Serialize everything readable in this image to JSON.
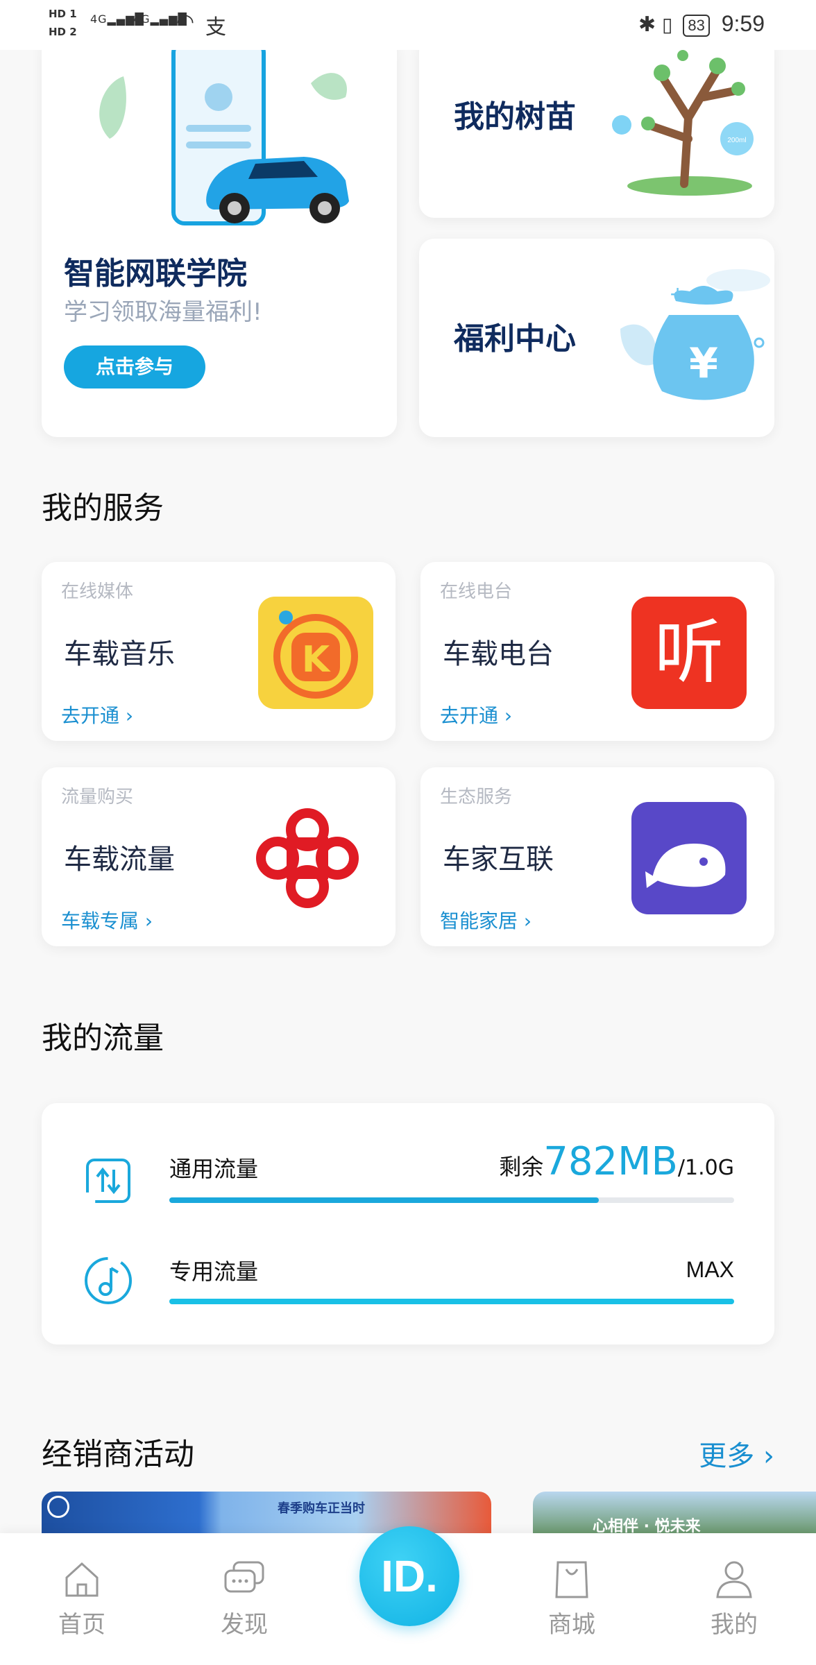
{
  "status_bar": {
    "hd1": "HD 1",
    "hd2": "HD 2",
    "sig1": "4G",
    "sig2": "4G",
    "battery": "83",
    "time": "9:59"
  },
  "promo": {
    "academy": {
      "title": "智能网联学院",
      "subtitle": "学习领取海量福利!",
      "button": "点击参与"
    },
    "sapling": {
      "title": "我的树苗",
      "badge": "200ml"
    },
    "welfare": {
      "title": "福利中心",
      "symbol": "¥"
    }
  },
  "services": {
    "title": "我的服务",
    "items": [
      {
        "category": "在线媒体",
        "name": "车载音乐",
        "link": "去开通",
        "icon": "kugou-music-icon",
        "color": "#f7d23e"
      },
      {
        "category": "在线电台",
        "name": "车载电台",
        "link": "去开通",
        "icon": "ting-radio-icon",
        "color": "#ee3322",
        "logo_text": "听"
      },
      {
        "category": "流量购买",
        "name": "车载流量",
        "link": "车载专属",
        "icon": "china-unicom-icon",
        "color": "#e01b24"
      },
      {
        "category": "生态服务",
        "name": "车家互联",
        "link": "智能家居",
        "icon": "whale-home-icon",
        "color": "#5848c8"
      }
    ]
  },
  "data_usage": {
    "title": "我的流量",
    "general": {
      "label": "通用流量",
      "remaining_prefix": "剩余",
      "remaining": "782MB",
      "total": "/1.0G",
      "fraction_used": 0.76
    },
    "dedicated": {
      "label": "专用流量",
      "value": "MAX",
      "fraction_used": 1.0
    }
  },
  "dealer": {
    "title": "经销商活动",
    "more": "更多",
    "banner1_text": "春季购车正当时",
    "banner2_text": "心相伴 · 悦未来"
  },
  "nav": {
    "home": "首页",
    "discover": "发现",
    "center": "ID.",
    "shop": "商城",
    "mine": "我的"
  },
  "colors": {
    "accent": "#16a6e0",
    "title": "#0f2b5e",
    "link": "#1a8fd0"
  }
}
